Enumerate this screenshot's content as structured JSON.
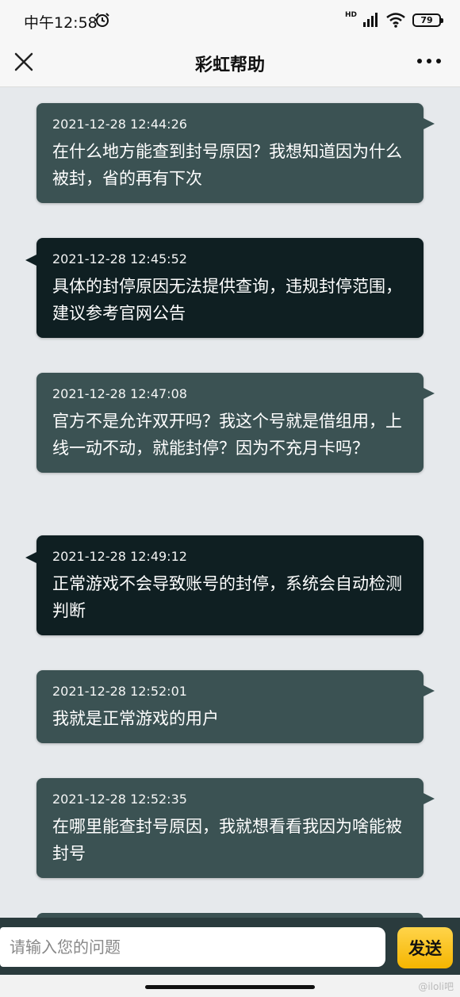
{
  "status_bar": {
    "time": "中午12:58",
    "network": "HD",
    "battery": "79"
  },
  "header": {
    "title": "彩虹帮助"
  },
  "messages": [
    {
      "side": "sent",
      "timestamp": "2021-12-28 12:44:26",
      "text": "在什么地方能查到封号原因？我想知道因为什么被封，省的再有下次"
    },
    {
      "side": "recv",
      "timestamp": "2021-12-28 12:45:52",
      "text": "具体的封停原因无法提供查询，违规封停范围，建议参考官网公告"
    },
    {
      "side": "sent",
      "timestamp": "2021-12-28 12:47:08",
      "text": "官方不是允许双开吗？我这个号就是借组用，上线一动不动，就能封停？因为不充月卡吗？"
    },
    {
      "side": "recv",
      "timestamp": "2021-12-28 12:49:12",
      "text": "正常游戏不会导致账号的封停，系统会自动检测判断"
    },
    {
      "side": "sent",
      "timestamp": "2021-12-28 12:52:01",
      "text": "我就是正常游戏的用户"
    },
    {
      "side": "sent",
      "timestamp": "2021-12-28 12:52:35",
      "text": "在哪里能查封号原因，我就想看看我因为啥能被封号"
    }
  ],
  "input": {
    "placeholder": "请输入您的问题",
    "send_label": "发送"
  },
  "watermark": "@iloli吧",
  "colors": {
    "sent_bubble": "#3b5253",
    "recv_bubble": "#0f1f22",
    "send_button": "#f5b500"
  }
}
